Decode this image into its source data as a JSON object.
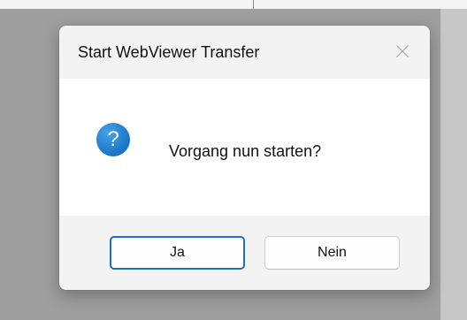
{
  "dialog": {
    "title": "Start WebViewer Transfer",
    "close_icon": "close-icon",
    "message_icon": "question-icon",
    "message_icon_glyph": "?",
    "message": "Vorgang nun starten?",
    "buttons": {
      "yes_label": "Ja",
      "no_label": "Nein"
    },
    "default_button": "yes"
  },
  "colors": {
    "accent": "#1f6fba",
    "icon_blue": "#2b8ad9",
    "title_bar": "#f3f3f3",
    "content_bg": "#ffffff"
  }
}
